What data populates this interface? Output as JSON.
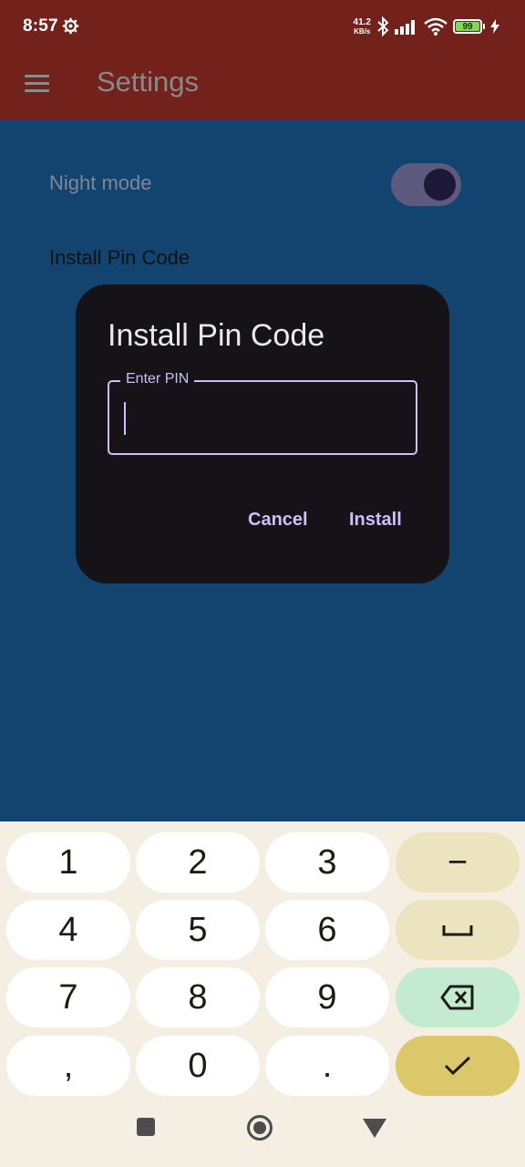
{
  "status_bar": {
    "time": "8:57",
    "net_speed_value": "41.2",
    "net_speed_unit": "KB/s",
    "battery_level": 99,
    "battery_level_text": "99",
    "icons": [
      "settings-gear-icon",
      "bluetooth-icon",
      "signal-icon",
      "wifi-icon",
      "battery-icon",
      "charging-icon"
    ]
  },
  "app_bar": {
    "title": "Settings",
    "menu_icon": "menu-icon"
  },
  "settings": {
    "night_mode_label": "Night mode",
    "night_mode_on": true,
    "install_pin_label": "Install Pin Code"
  },
  "dialog": {
    "title": "Install Pin Code",
    "field_label": "Enter PIN",
    "field_value": "",
    "cancel_label": "Cancel",
    "install_label": "Install",
    "accent": "#d0bcff"
  },
  "keyboard": {
    "keys": [
      {
        "label": "1",
        "kind": "num"
      },
      {
        "label": "2",
        "kind": "num"
      },
      {
        "label": "3",
        "kind": "num"
      },
      {
        "label": "−",
        "kind": "util"
      },
      {
        "label": "4",
        "kind": "num"
      },
      {
        "label": "5",
        "kind": "num"
      },
      {
        "label": "6",
        "kind": "num"
      },
      {
        "label": "␣",
        "kind": "util",
        "icon": "space-icon"
      },
      {
        "label": "7",
        "kind": "num"
      },
      {
        "label": "8",
        "kind": "num"
      },
      {
        "label": "9",
        "kind": "num"
      },
      {
        "label": "",
        "kind": "back",
        "icon": "backspace-icon"
      },
      {
        "label": ",",
        "kind": "num"
      },
      {
        "label": "0",
        "kind": "num"
      },
      {
        "label": ".",
        "kind": "num"
      },
      {
        "label": "",
        "kind": "done",
        "icon": "checkmark-icon"
      }
    ]
  },
  "nav_bar": {
    "icons": [
      "recents-icon",
      "home-icon",
      "back-icon"
    ]
  },
  "colors": {
    "app_bar": "#72211b",
    "background": "#12446f",
    "dialog": "#161318",
    "keyboard": "#f4eee3"
  }
}
